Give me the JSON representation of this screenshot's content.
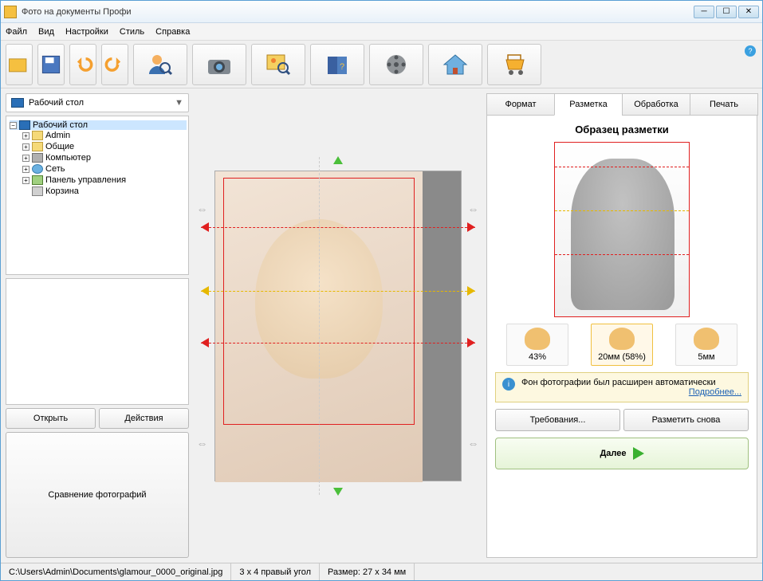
{
  "titlebar": {
    "title": "Фото на документы Профи"
  },
  "menu": {
    "file": "Файл",
    "view": "Вид",
    "settings": "Настройки",
    "style": "Стиль",
    "help": "Справка"
  },
  "sidebar": {
    "combo": "Рабочий стол",
    "tree": {
      "root": "Рабочий стол",
      "items": [
        "Admin",
        "Общие",
        "Компьютер",
        "Сеть",
        "Панель управления",
        "Корзина"
      ]
    },
    "open": "Открыть",
    "actions": "Действия",
    "compare": "Сравнение фотографий"
  },
  "tabs": {
    "format": "Формат",
    "markup": "Разметка",
    "process": "Обработка",
    "print": "Печать"
  },
  "panel": {
    "heading": "Образец разметки",
    "metrics": {
      "m1": "43%",
      "m2": "20мм (58%)",
      "m3": "5мм"
    },
    "info_text": "Фон фотографии был расширен автоматически",
    "info_link": "Подробнее...",
    "requirements": "Требования...",
    "remark": "Разметить снова",
    "next": "Далее"
  },
  "status": {
    "path": "C:\\Users\\Admin\\Documents\\glamour_0000_original.jpg",
    "format": "3 x 4 правый угол",
    "size": "Размер: 27 x 34 мм"
  }
}
